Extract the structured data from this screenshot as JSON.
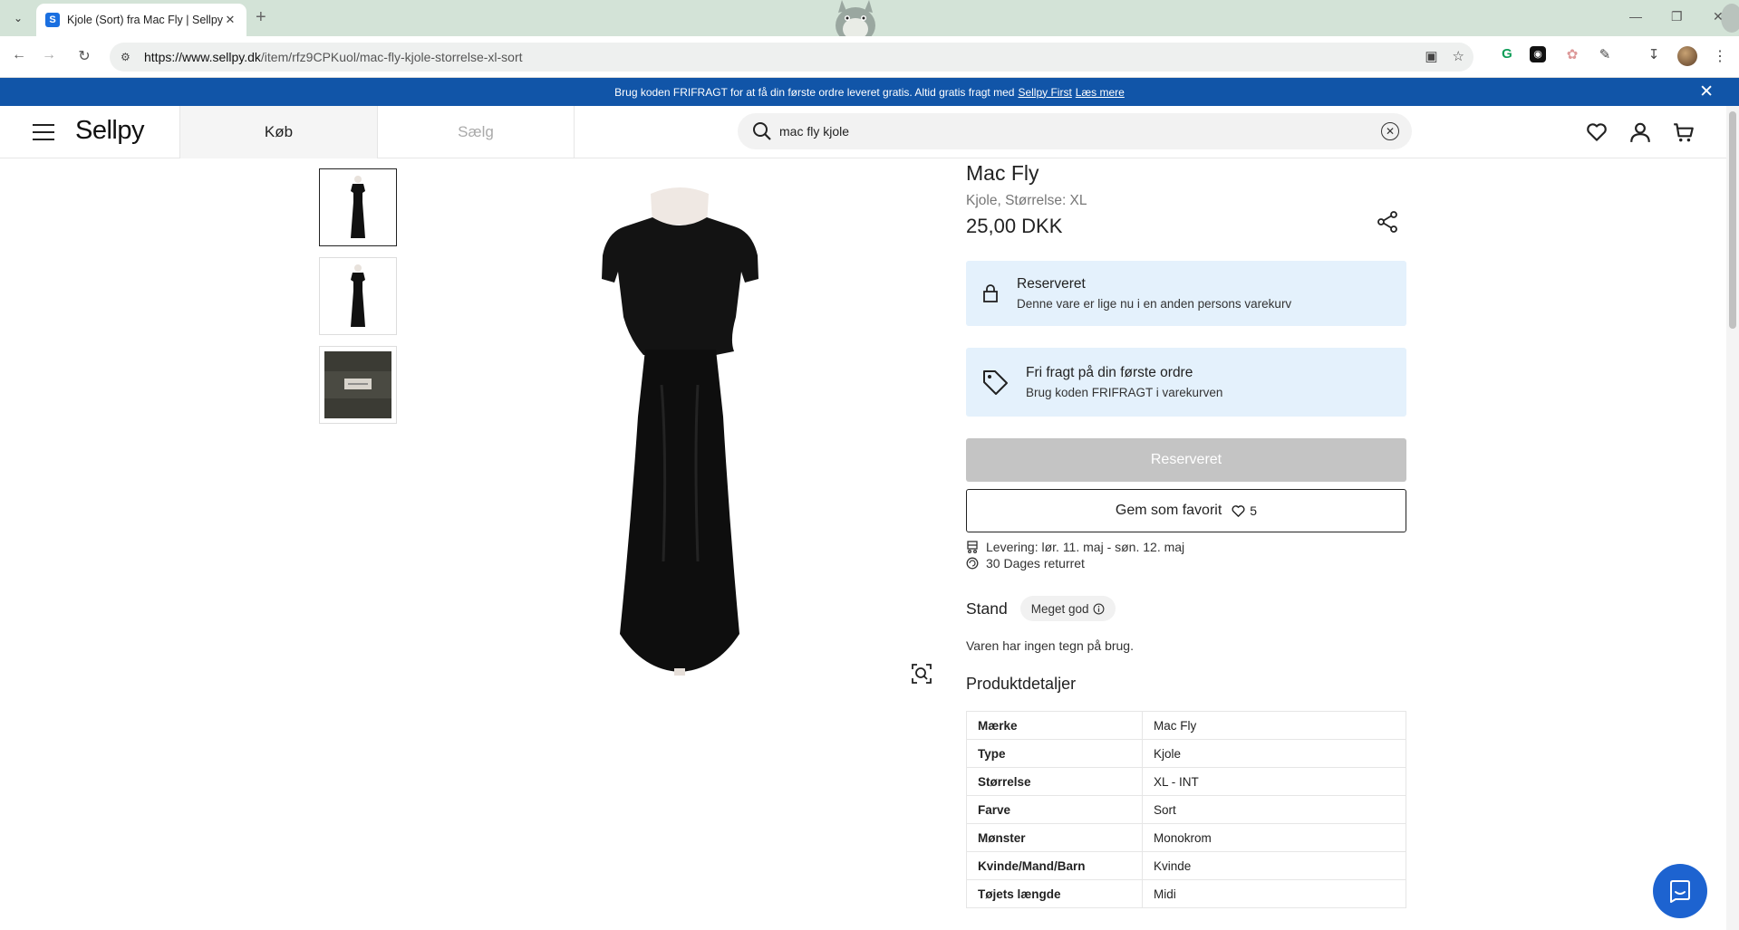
{
  "browser": {
    "tab_title": "Kjole (Sort) fra Mac Fly | Sellpy",
    "favicon_letter": "S",
    "url_domain": "https://www.sellpy.dk",
    "url_path": "/item/rfz9CPKuol/mac-fly-kjole-storrelse-xl-sort"
  },
  "promo": {
    "text": "Brug koden FRIFRAGT for at få din første ordre leveret gratis. Altid gratis fragt med",
    "link1": "Sellpy First",
    "link2": "Læs mere"
  },
  "header": {
    "logo": "Sellpy",
    "tab_buy": "Køb",
    "tab_sell": "Sælg",
    "search_value": "mac fly kjole"
  },
  "product": {
    "brand": "Mac Fly",
    "subtitle": "Kjole, Størrelse: XL",
    "price": "25,00 DKK",
    "reserved_notice": {
      "title": "Reserveret",
      "text": "Denne vare er lige nu i en anden persons varekurv"
    },
    "shipping_notice": {
      "title": "Fri fragt på din første ordre",
      "text": "Brug koden FRIFRAGT i varekurven"
    },
    "reserved_button": "Reserveret",
    "favorite_button": "Gem som favorit",
    "favorite_count": "5",
    "delivery": "Levering: lør. 11. maj - søn. 12. maj",
    "returns": "30 Dages returret",
    "condition_label": "Stand",
    "condition_value": "Meget god",
    "condition_text": "Varen har ingen tegn på brug.",
    "details_heading": "Produktdetaljer",
    "details": [
      {
        "key": "Mærke",
        "value": "Mac Fly"
      },
      {
        "key": "Type",
        "value": "Kjole"
      },
      {
        "key": "Størrelse",
        "value": "XL - INT"
      },
      {
        "key": "Farve",
        "value": "Sort"
      },
      {
        "key": "Mønster",
        "value": "Monokrom"
      },
      {
        "key": "Kvinde/Mand/Barn",
        "value": "Kvinde"
      },
      {
        "key": "Tøjets længde",
        "value": "Midi"
      }
    ]
  },
  "colors": {
    "promo_bg": "#1155a8",
    "notice_bg": "#e4f1fc",
    "reserved_btn": "#c4c4c4",
    "chat_bg": "#1d63d0"
  }
}
